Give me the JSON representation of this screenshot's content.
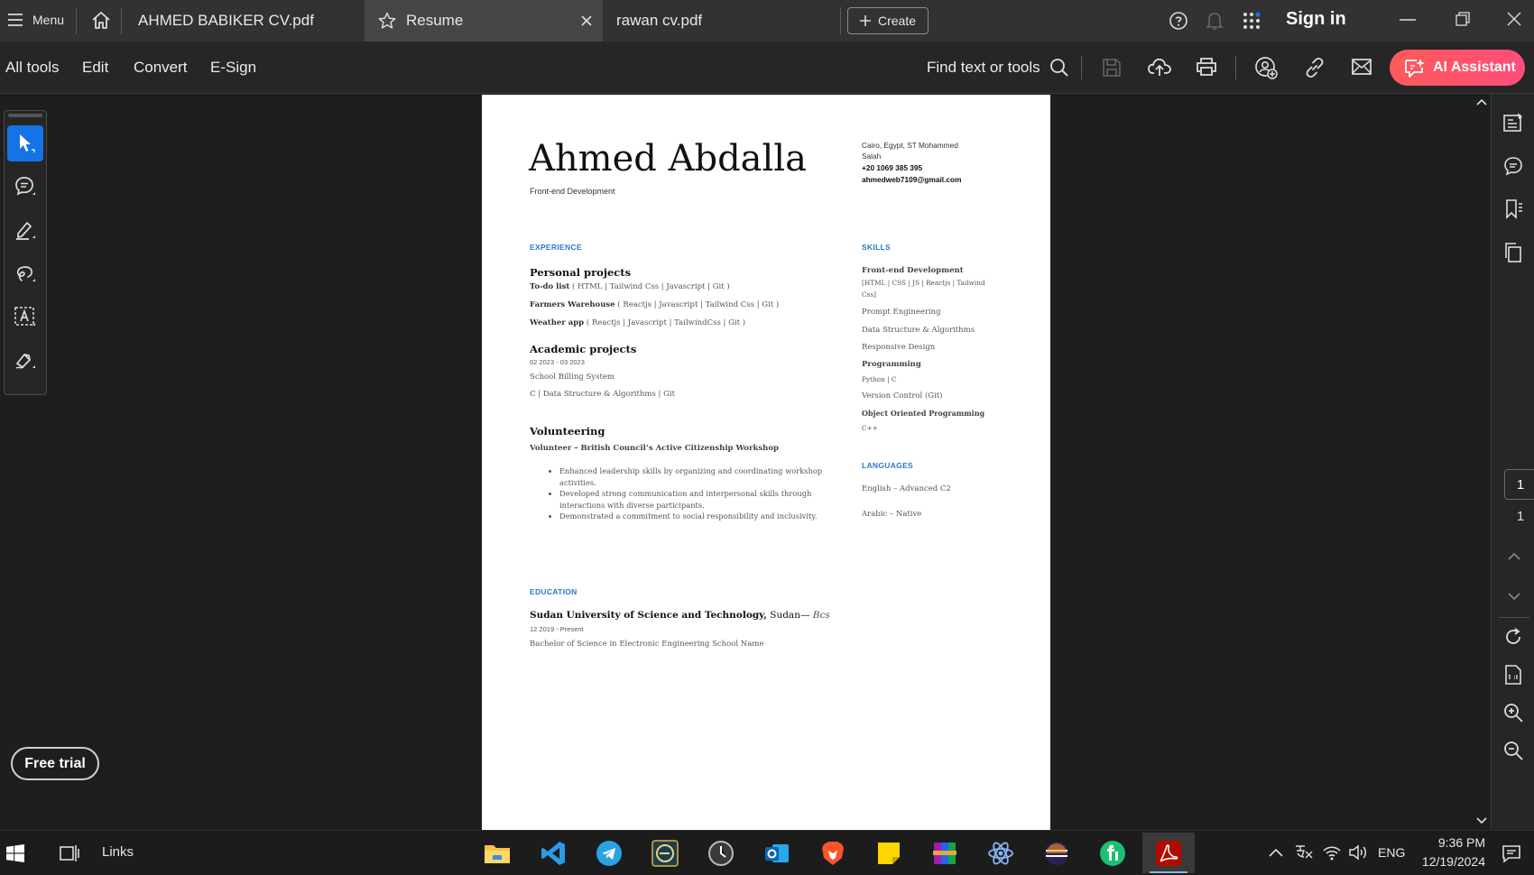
{
  "tabbar": {
    "menu_label": "Menu",
    "tabs": [
      {
        "label": "AHMED BABIKER CV.pdf"
      },
      {
        "label": "Resume"
      },
      {
        "label": "rawan cv.pdf"
      }
    ],
    "create_label": "Create",
    "sign_in_label": "Sign in"
  },
  "toolbar": {
    "all_tools": "All tools",
    "edit": "Edit",
    "convert": "Convert",
    "esign": "E-Sign",
    "find_label": "Find text or tools",
    "ai_assistant": "AI Assistant"
  },
  "left_rail": {
    "free_trial": "Free trial"
  },
  "right_rail": {
    "page_current": "1",
    "page_total": "1"
  },
  "resume": {
    "name": "Ahmed Abdalla",
    "title": "Front-end Development",
    "address_line1": "Cairo, Egypt, ST Mohammed",
    "address_line2": "Salah",
    "phone": "+20 1069 385 395",
    "email": "ahmedweb7109@gmail.com",
    "experience_heading": "EXPERIENCE",
    "personal_projects_heading": "Personal projects",
    "projects": [
      {
        "name": "To-do list",
        "stack": " ( HTML | Tailwind Css | Javascript | Git )"
      },
      {
        "name": "Farmers Warehouse",
        "stack": " ( Reactjs | Javascript | Tailwind Css | Git )"
      },
      {
        "name": "Weather app",
        "stack": " ( Reactjs | Javascript | TailwindCss | Git )"
      }
    ],
    "academic_heading": "Academic projects",
    "academic_dates": "02 2023 - 03 2023",
    "academic_project": "School Billing System",
    "academic_stack": "C | Data Structure & Algorithms | Git",
    "volunteering_heading": "Volunteering",
    "volunteer_role": "Volunteer – British Council’s Active Citizenship Workshop",
    "volunteer_bullets": [
      "Enhanced leadership skills by organizing and coordinating workshop activities.",
      "Developed strong communication and interpersonal skills through interactions with diverse participants.",
      "Demonstrated a commitment to social responsibility and inclusivity."
    ],
    "skills_heading": "SKILLS",
    "skill_frontend": "Front-end Development",
    "skill_frontend_detail1": "[HTML | CSS | JS | Reactjs | Tailwind",
    "skill_frontend_detail2": "Css]",
    "skill_prompt": "Prompt Engineering",
    "skill_dsa": "Data Structure & Algorithms",
    "skill_responsive": "Responsive Design",
    "skill_programming": "Programming",
    "skill_programming_detail": "Python | C",
    "skill_vc": "Version Control (Git)",
    "skill_oop": "Object Oriented Programming",
    "skill_cpp": "C++",
    "languages_heading": "LANGUAGES",
    "lang_english": "English – Advanced C2",
    "lang_arabic": "Arabic – Native",
    "education_heading": "EDUCATION",
    "edu_school": "Sudan University of Science and Technology,",
    "edu_city": " Sudan— ",
    "edu_degree_short": "Bcs",
    "edu_dates": "12 2019 - Present",
    "edu_degree": "Bachelor of Science in Electronic Engineering School Name"
  },
  "taskbar": {
    "links_label": "Links",
    "lang": "ENG",
    "time": "9:36 PM",
    "date": "12/19/2024"
  },
  "colors": {
    "accent_blue": "#1473e6",
    "ai_gradient": "#ff5a5a",
    "section_blue": "#2a77c9"
  }
}
